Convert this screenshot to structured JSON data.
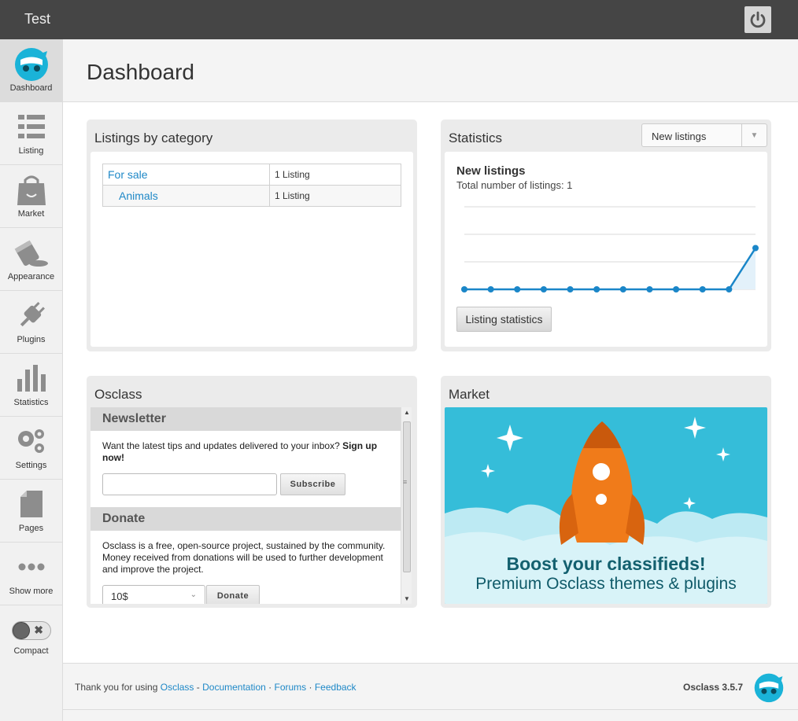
{
  "topbar": {
    "site_title": "Test",
    "power_icon": "power-icon"
  },
  "sidebar": {
    "items": [
      {
        "label": "Dashboard",
        "icon": "osclass-logo-icon",
        "active": true
      },
      {
        "label": "Listing",
        "icon": "list-icon"
      },
      {
        "label": "Market",
        "icon": "shopping-bag-icon"
      },
      {
        "label": "Appearance",
        "icon": "paint-bucket-icon"
      },
      {
        "label": "Plugins",
        "icon": "plug-icon"
      },
      {
        "label": "Statistics",
        "icon": "bar-chart-icon"
      },
      {
        "label": "Settings",
        "icon": "gears-icon"
      },
      {
        "label": "Pages",
        "icon": "page-icon"
      },
      {
        "label": "Show more",
        "icon": "dots-icon"
      }
    ],
    "compact_label": "Compact"
  },
  "header": {
    "title": "Dashboard"
  },
  "listings_panel": {
    "title": "Listings by category",
    "rows": [
      {
        "category": "For sale",
        "count": "1 Listing"
      },
      {
        "category": "Animals",
        "count": "1 Listing"
      }
    ]
  },
  "stats_panel": {
    "title": "Statistics",
    "select_value": "New listings",
    "heading": "New listings",
    "subheading": "Total number of listings: 1",
    "button": "Listing statistics"
  },
  "osclass_panel": {
    "title": "Osclass",
    "newsletter_title": "Newsletter",
    "newsletter_text": "Want the latest tips and updates delivered to your inbox?",
    "newsletter_bold": "Sign up now!",
    "email_value": "",
    "subscribe": "Subscribe",
    "donate_title": "Donate",
    "donate_text": "Osclass is a free, open-source project, sustained by the community. Money received from donations will be used to further development and improve the project.",
    "donate_amount": "10$",
    "donate_button": "Donate"
  },
  "market_panel": {
    "title": "Market",
    "banner_line1": "Boost your classifieds!",
    "banner_line2": "Premium Osclass themes & plugins"
  },
  "footer": {
    "thanks": "Thank you for using",
    "osclass": "Osclass",
    "sep1": " - ",
    "documentation": "Documentation",
    "sep2": " · ",
    "forums": "Forums",
    "sep3": " · ",
    "feedback": "Feedback",
    "version": "Osclass 3.5.7"
  },
  "colors": {
    "accent": "#1e88c7",
    "topbar": "#454545",
    "chart": "#1a86c8",
    "banner": "#35bdd9",
    "rocket": "#f07b1a"
  },
  "chart_data": {
    "type": "line",
    "series": [
      {
        "values": [
          0,
          0,
          0,
          0,
          0,
          0,
          0,
          0,
          0,
          0,
          0,
          1
        ]
      }
    ],
    "xlabel": "",
    "ylabel": "",
    "ylim": [
      0,
      2
    ],
    "grid": true
  }
}
